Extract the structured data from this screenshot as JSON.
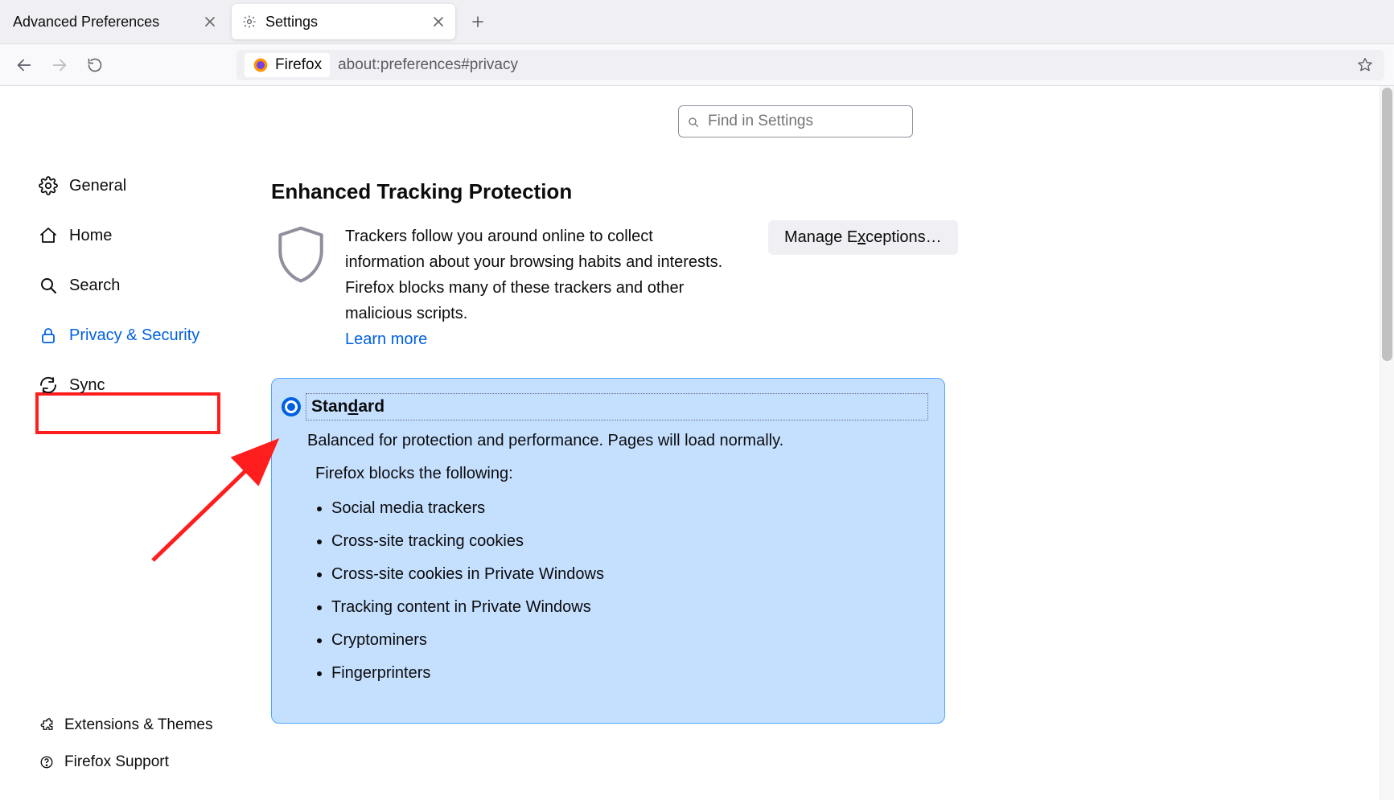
{
  "tabs": [
    {
      "title": "Advanced Preferences",
      "active": false
    },
    {
      "title": "Settings",
      "active": true
    }
  ],
  "identity_label": "Firefox",
  "url": "about:preferences#privacy",
  "find_placeholder": "Find in Settings",
  "sidebar": {
    "items": [
      {
        "label": "General"
      },
      {
        "label": "Home"
      },
      {
        "label": "Search"
      },
      {
        "label": "Privacy & Security"
      },
      {
        "label": "Sync"
      }
    ],
    "footer": [
      {
        "label": "Extensions & Themes"
      },
      {
        "label": "Firefox Support"
      }
    ]
  },
  "etp": {
    "title": "Enhanced Tracking Protection",
    "desc": "Trackers follow you around online to collect information about your browsing habits and interests. Firefox blocks many of these trackers and other malicious scripts.",
    "learn_more": "Learn more",
    "manage_btn": "Manage Exceptions…"
  },
  "standard": {
    "label_pre": "Stan",
    "label_ul": "d",
    "label_post": "ard",
    "sub": "Balanced for protection and performance. Pages will load normally.",
    "blocks_label": "Firefox blocks the following:",
    "items": [
      "Social media trackers",
      "Cross-site tracking cookies",
      "Cross-site cookies in Private Windows",
      "Tracking content in Private Windows",
      "Cryptominers",
      "Fingerprinters"
    ]
  }
}
